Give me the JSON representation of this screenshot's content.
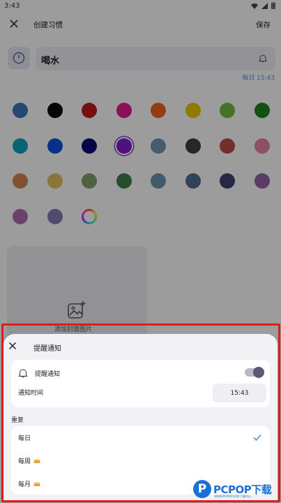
{
  "status_bar": {
    "time": "3:43"
  },
  "app_bar": {
    "title": "创建习惯",
    "save_label": "保存",
    "close_icon": "close-icon"
  },
  "habit": {
    "name": "喝水",
    "reminder_hint": "每日 15:43"
  },
  "colors": [
    "#3d6fb5",
    "#0a0a0a",
    "#b71c1c",
    "#d81b8a",
    "#e8601c",
    "#e0c000",
    "#6eb53c",
    "#1e7d1e",
    "#0b9bb8",
    "#0b4fd6",
    "#0a0a6e",
    "#7b1bc4",
    "#6f8fae",
    "#3e3e3e",
    "#b24a44",
    "#e07c9a",
    "#c8814e",
    "#d6b95a",
    "#7c9a63",
    "#3e7a46",
    "#688fa7",
    "#4d6a8c",
    "#3c3f6e",
    "#8a5f9c",
    "#a86aa6",
    "#7a75b0",
    "rainbow"
  ],
  "selected_color_index": 11,
  "image_card": {
    "label": "添加封面图片"
  },
  "sheet": {
    "title": "提醒通知",
    "notify_label": "提醒通知",
    "notify_enabled": true,
    "time_label": "通知时间",
    "time_value": "15:43",
    "repeat_label": "重复",
    "repeat_options": [
      {
        "label": "每日",
        "selected": true,
        "premium": false
      },
      {
        "label": "每周",
        "selected": false,
        "premium": true
      },
      {
        "label": "每月",
        "selected": false,
        "premium": true
      }
    ]
  },
  "watermark": {
    "brand": "PCPOP下载",
    "letter": "P",
    "sub": "WWW.PCPOP.COM 下载中心"
  },
  "accent": "#5e5878",
  "hint_color": "#5b8fcc",
  "check_color": "#5b8fcc",
  "crown_color": "#e8a33c",
  "frame_color": "#e11a1a"
}
